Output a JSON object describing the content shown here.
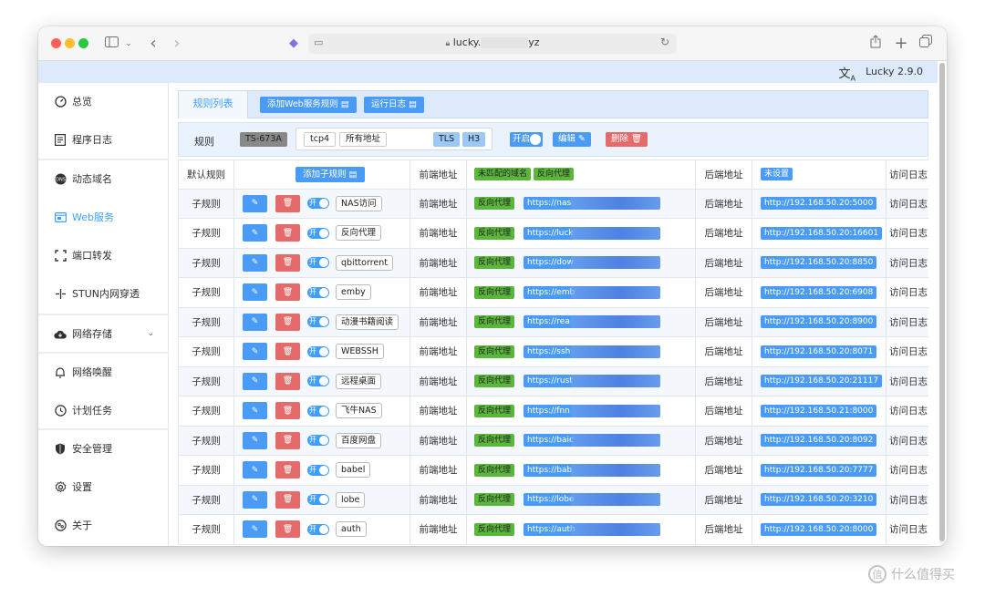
{
  "browser": {
    "url_prefix": "lucky.",
    "url_suffix": "yz",
    "nav_icons": [
      "sidebar-icon",
      "back-icon",
      "forward-icon",
      "reload-icon",
      "share-icon",
      "new-tab-icon",
      "tabs-icon"
    ]
  },
  "app": {
    "version": "Lucky 2.9.0",
    "lang_icon": "translate-icon"
  },
  "sidebar": {
    "items": [
      {
        "label": "总览",
        "icon": "dashboard-icon"
      },
      {
        "label": "程序日志",
        "icon": "log-icon"
      },
      {
        "label": "动态域名",
        "icon": "dns-icon"
      },
      {
        "label": "Web服务",
        "icon": "web-icon",
        "active": true
      },
      {
        "label": "端口转发",
        "icon": "port-forward-icon"
      },
      {
        "label": "STUN内网穿透",
        "icon": "stun-icon"
      },
      {
        "label": "网络存储",
        "icon": "cloud-storage-icon",
        "expandable": true
      },
      {
        "label": "网络唤醒",
        "icon": "bell-icon"
      },
      {
        "label": "计划任务",
        "icon": "clock-icon"
      },
      {
        "label": "安全管理",
        "icon": "shield-icon"
      },
      {
        "label": "设置",
        "icon": "gear-icon"
      },
      {
        "label": "关于",
        "icon": "about-icon"
      }
    ]
  },
  "tabs": {
    "active": "规则列表",
    "add_rule": "添加Web服务规则",
    "run_log": "运行日志"
  },
  "rule": {
    "label": "规则",
    "name": "TS-673A",
    "protocol": "tcp4",
    "address": "所有地址",
    "tls": "TLS",
    "h3": "H3",
    "enabled_label": "开启",
    "edit": "编辑",
    "delete": "删除"
  },
  "table": {
    "default_rule": "默认规则",
    "add_sub_rule": "添加子规则",
    "frontend_addr": "前端地址",
    "unmatched_domain": "未匹配的域名",
    "reverse_proxy": "反向代理",
    "backend_addr": "后端地址",
    "not_set": "未设置",
    "access_log": "访问日志",
    "toggle_on": "开",
    "rows": [
      {
        "type": "子规则",
        "name": "NAS访问",
        "url": "https://nas",
        "backend": "http://192.168.50.20:5000"
      },
      {
        "type": "子规则",
        "name": "反向代理",
        "url": "https://luck",
        "backend": "http://192.168.50.20:16601"
      },
      {
        "type": "子规则",
        "name": "qbittorrent",
        "url": "https://dow",
        "backend": "http://192.168.50.20:8850"
      },
      {
        "type": "子规则",
        "name": "emby",
        "url": "https://emb",
        "backend": "http://192.168.50.20:6908"
      },
      {
        "type": "子规则",
        "name": "动漫书籍阅读",
        "url": "https://rea",
        "backend": "http://192.168.50.20:8900"
      },
      {
        "type": "子规则",
        "name": "WEBSSH",
        "url": "https://ssh",
        "backend": "http://192.168.50.20:8071"
      },
      {
        "type": "子规则",
        "name": "远程桌面",
        "url": "https://rust",
        "backend": "http://192.168.50.20:21117"
      },
      {
        "type": "子规则",
        "name": "飞牛NAS",
        "url": "https://fnn",
        "backend": "http://192.168.50.21:8000"
      },
      {
        "type": "子规则",
        "name": "百度网盘",
        "url": "https://baic",
        "backend": "http://192.168.50.20:8092"
      },
      {
        "type": "子规则",
        "name": "babel",
        "url": "https://bab",
        "backend": "http://192.168.50.20:7777"
      },
      {
        "type": "子规则",
        "name": "lobe",
        "url": "https://lobe",
        "backend": "http://192.168.50.20:3210"
      },
      {
        "type": "子规则",
        "name": "auth",
        "url": "https://auth",
        "backend": "http://192.168.50.20:8000"
      }
    ]
  },
  "watermark": "什么值得买"
}
